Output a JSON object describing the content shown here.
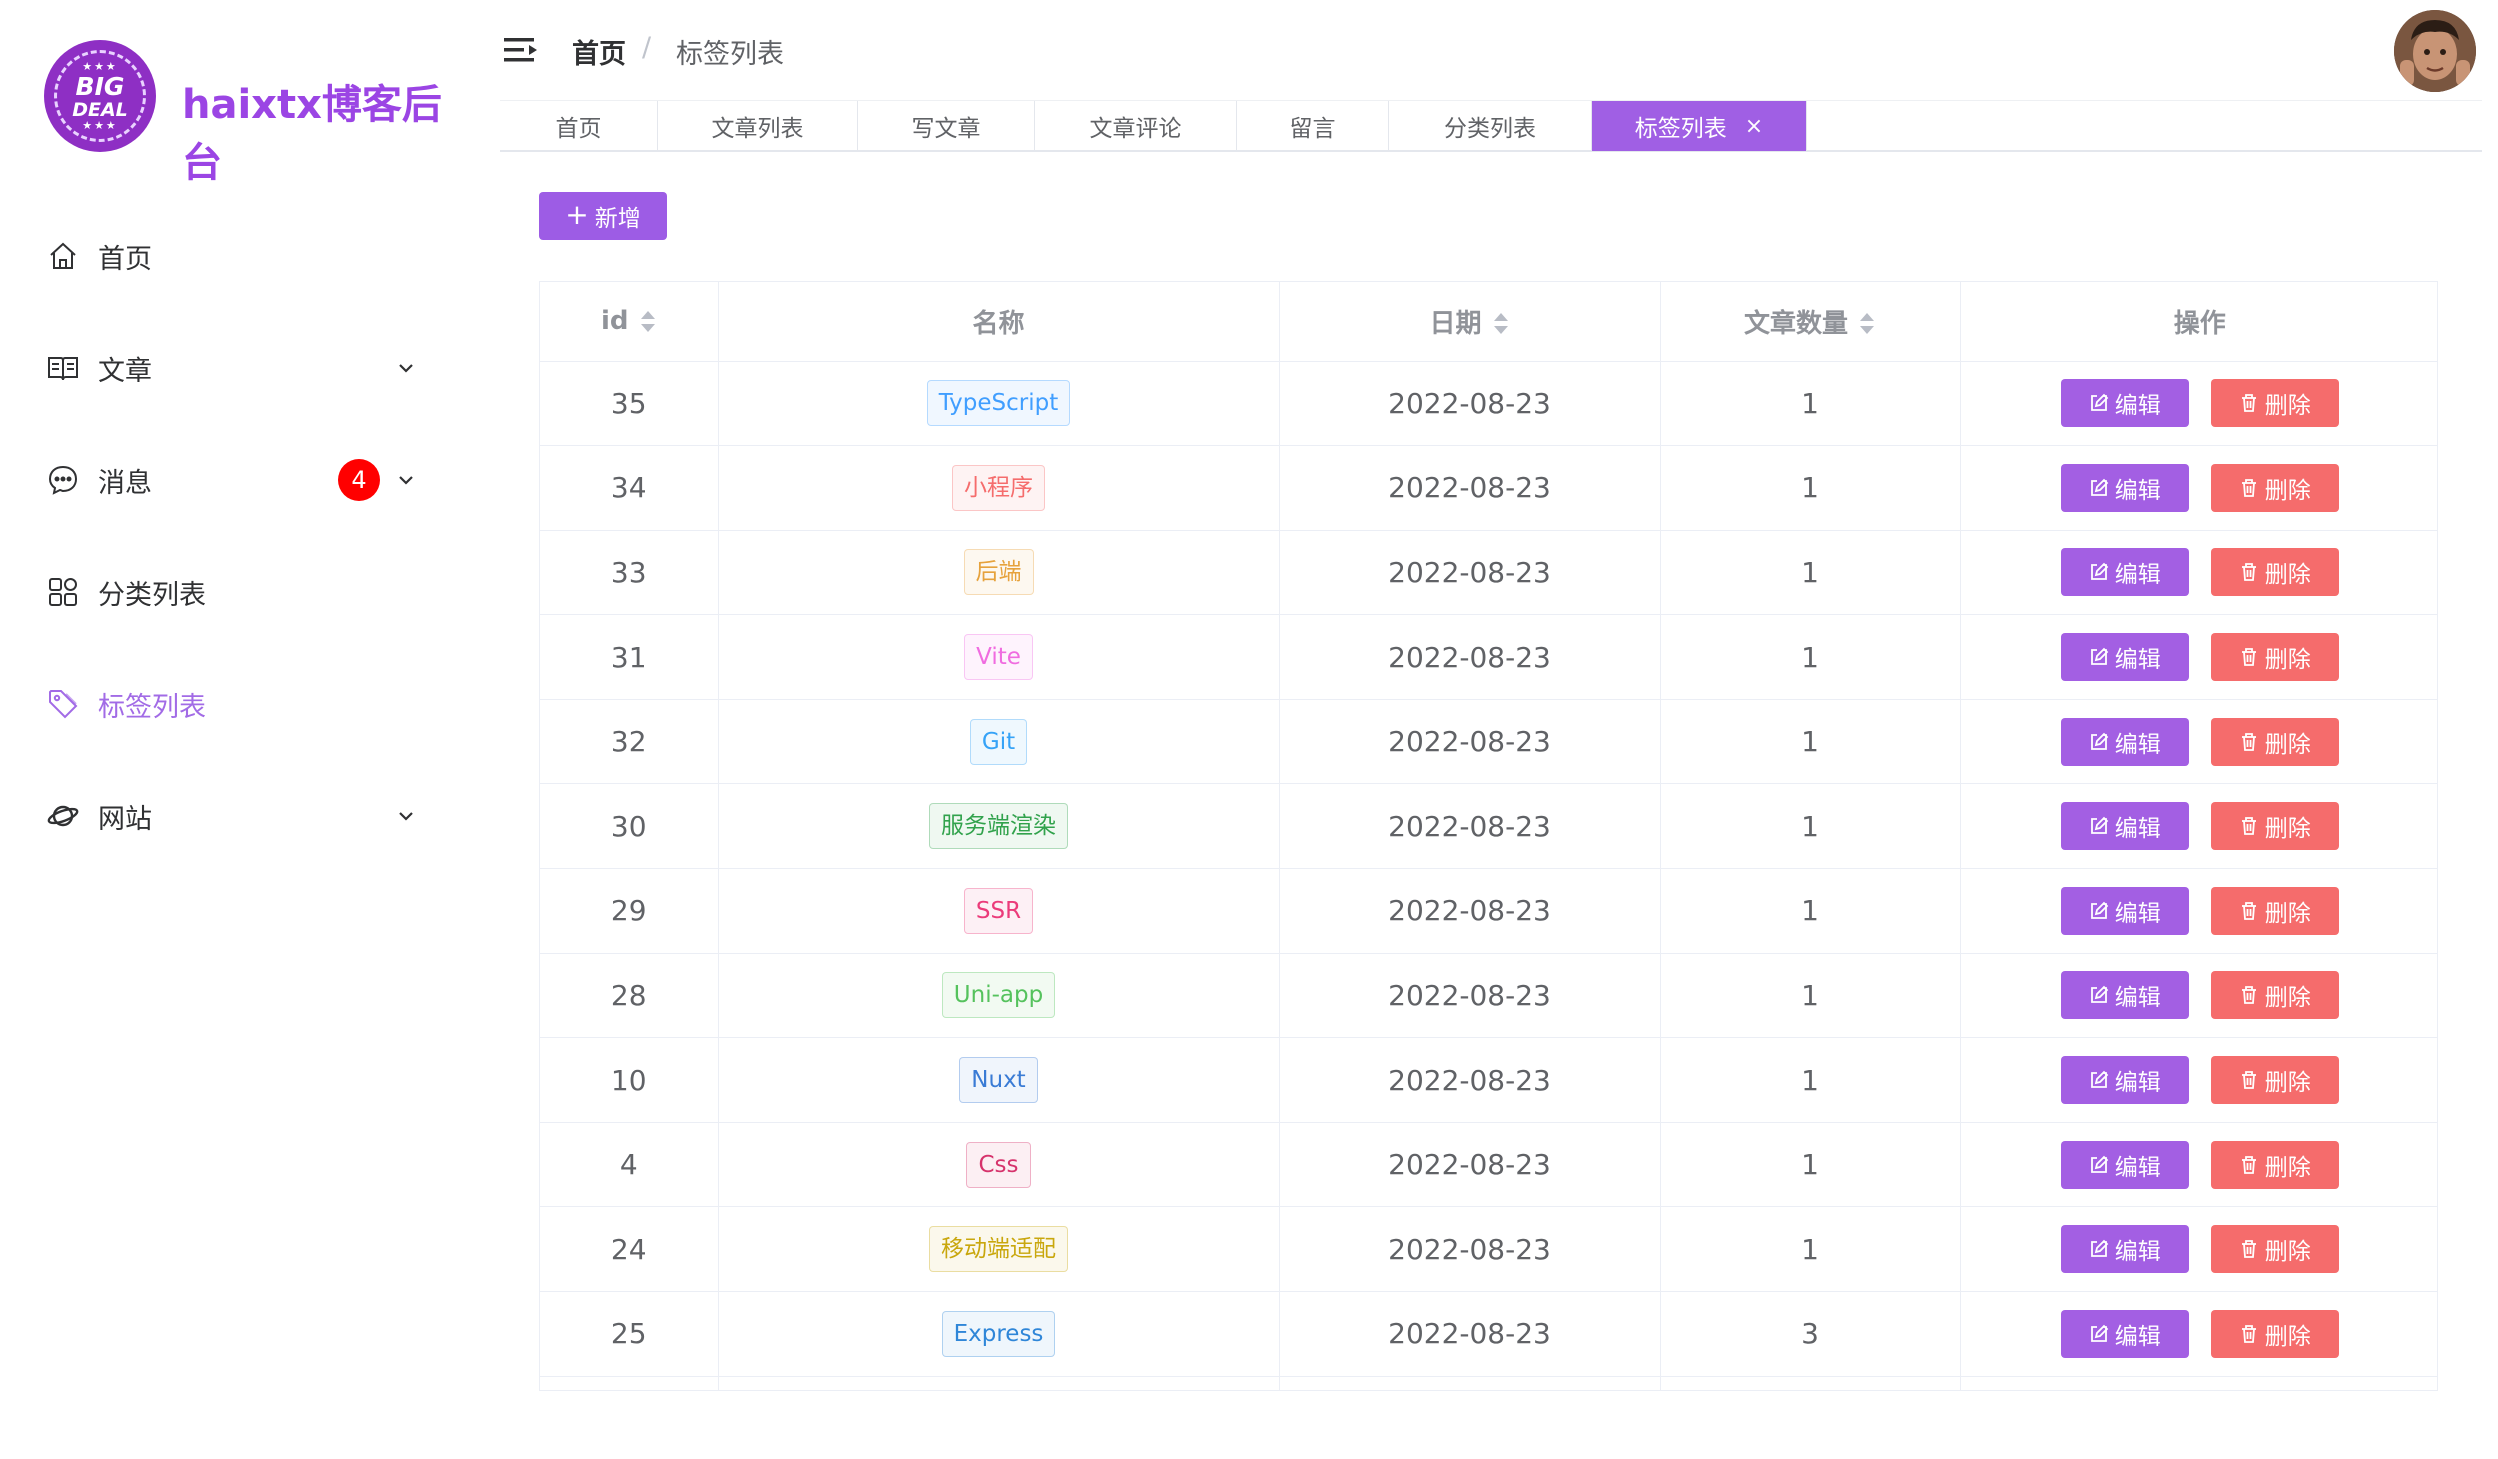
{
  "brand": {
    "logo_line1": "BIG",
    "logo_line2": "DEAL",
    "name": "haixtx博客后台"
  },
  "sidebar": {
    "items": [
      {
        "label": "首页",
        "icon": "home-icon"
      },
      {
        "label": "文章",
        "icon": "article-icon",
        "has_submenu": true
      },
      {
        "label": "消息",
        "icon": "message-icon",
        "has_submenu": true,
        "badge": "4"
      },
      {
        "label": "分类列表",
        "icon": "category-icon"
      },
      {
        "label": "标签列表",
        "icon": "tag-icon",
        "active": true
      },
      {
        "label": "网站",
        "icon": "planet-icon",
        "has_submenu": true
      }
    ]
  },
  "header": {
    "breadcrumb_home": "首页",
    "breadcrumb_sep": "/",
    "breadcrumb_current": "标签列表"
  },
  "tabs": [
    {
      "label": "首页"
    },
    {
      "label": "文章列表"
    },
    {
      "label": "写文章"
    },
    {
      "label": "文章评论"
    },
    {
      "label": "留言"
    },
    {
      "label": "分类列表"
    },
    {
      "label": "标签列表",
      "active": true,
      "close": "×"
    }
  ],
  "toolbar": {
    "add_label": "新增"
  },
  "table": {
    "columns": [
      "id",
      "名称",
      "日期",
      "文章数量",
      "操作"
    ],
    "edit_label": "编辑",
    "delete_label": "删除",
    "rows": [
      {
        "id": "35",
        "name": "TypeScript",
        "date": "2022-08-23",
        "count": "1",
        "tag_color": "#409eff"
      },
      {
        "id": "34",
        "name": "小程序",
        "date": "2022-08-23",
        "count": "1",
        "tag_color": "#f56c6c"
      },
      {
        "id": "33",
        "name": "后端",
        "date": "2022-08-23",
        "count": "1",
        "tag_color": "#e6a23c"
      },
      {
        "id": "31",
        "name": "Vite",
        "date": "2022-08-23",
        "count": "1",
        "tag_color": "#f06ce0"
      },
      {
        "id": "32",
        "name": "Git",
        "date": "2022-08-23",
        "count": "1",
        "tag_color": "#36a3f7"
      },
      {
        "id": "30",
        "name": "服务端渲染",
        "date": "2022-08-23",
        "count": "1",
        "tag_color": "#31a24c"
      },
      {
        "id": "29",
        "name": "SSR",
        "date": "2022-08-23",
        "count": "1",
        "tag_color": "#eb3b7a"
      },
      {
        "id": "28",
        "name": "Uni-app",
        "date": "2022-08-23",
        "count": "1",
        "tag_color": "#55c25d"
      },
      {
        "id": "10",
        "name": "Nuxt",
        "date": "2022-08-23",
        "count": "1",
        "tag_color": "#3a7bd5"
      },
      {
        "id": "4",
        "name": "Css",
        "date": "2022-08-23",
        "count": "1",
        "tag_color": "#d6336c"
      },
      {
        "id": "24",
        "name": "移动端适配",
        "date": "2022-08-23",
        "count": "1",
        "tag_color": "#c9a70d"
      },
      {
        "id": "25",
        "name": "Express",
        "date": "2022-08-23",
        "count": "3",
        "tag_color": "#2f86d8"
      }
    ]
  },
  "colors": {
    "primary": "#a05fe4",
    "danger": "#f56c6c",
    "badge": "#ff0000"
  }
}
